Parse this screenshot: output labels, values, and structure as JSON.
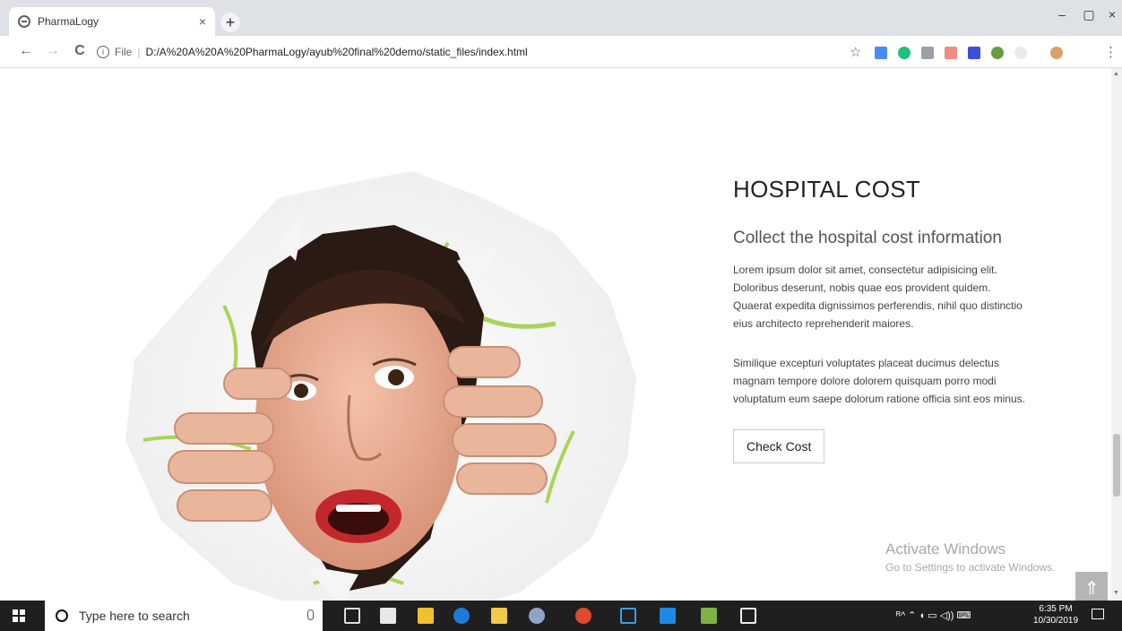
{
  "browser": {
    "tab_title": "PharmaLogy",
    "tab_close": "×",
    "new_tab": "+",
    "window_controls": [
      "–",
      "▢",
      "×"
    ],
    "nav": {
      "back": "←",
      "forward": "→",
      "reload": "C"
    },
    "address": {
      "info_glyph": "i",
      "scheme": "File",
      "url": "D:/A%20A%20A%20PharmaLogy/ayub%20final%20demo/static_files/index.html"
    },
    "star": "☆",
    "menu": "⋮"
  },
  "page": {
    "heading": "HOSPITAL COST",
    "subheading": "Collect the hospital cost information",
    "paragraph1": "Lorem ipsum dolor sit amet, consectetur adipisicing elit. Doloribus deserunt, nobis quae eos provident quidem. Quaerat expedita dignissimos perferendis, nihil quo distinctio eius architecto reprehenderit maiores.",
    "paragraph2": "Similique excepturi voluptates placeat ducimus delectus magnam tempore dolore dolorem quisquam porro modi voluptatum eum saepe dolorum ratione officia sint eos minus.",
    "button_label": "Check Cost",
    "back_to_top": "⇑"
  },
  "watermark": {
    "line1": "Activate Windows",
    "line2": "Go to Settings to activate Windows."
  },
  "taskbar": {
    "search_placeholder": "Type here to search",
    "time": "6:35 PM",
    "date": "10/30/2019",
    "tray": "ᴿ^  ⌃  ◖ ▭ ◁)) ⌨"
  },
  "colors": {
    "accent_green": "#a8d45a",
    "taskbar": "#1f1f1f"
  }
}
